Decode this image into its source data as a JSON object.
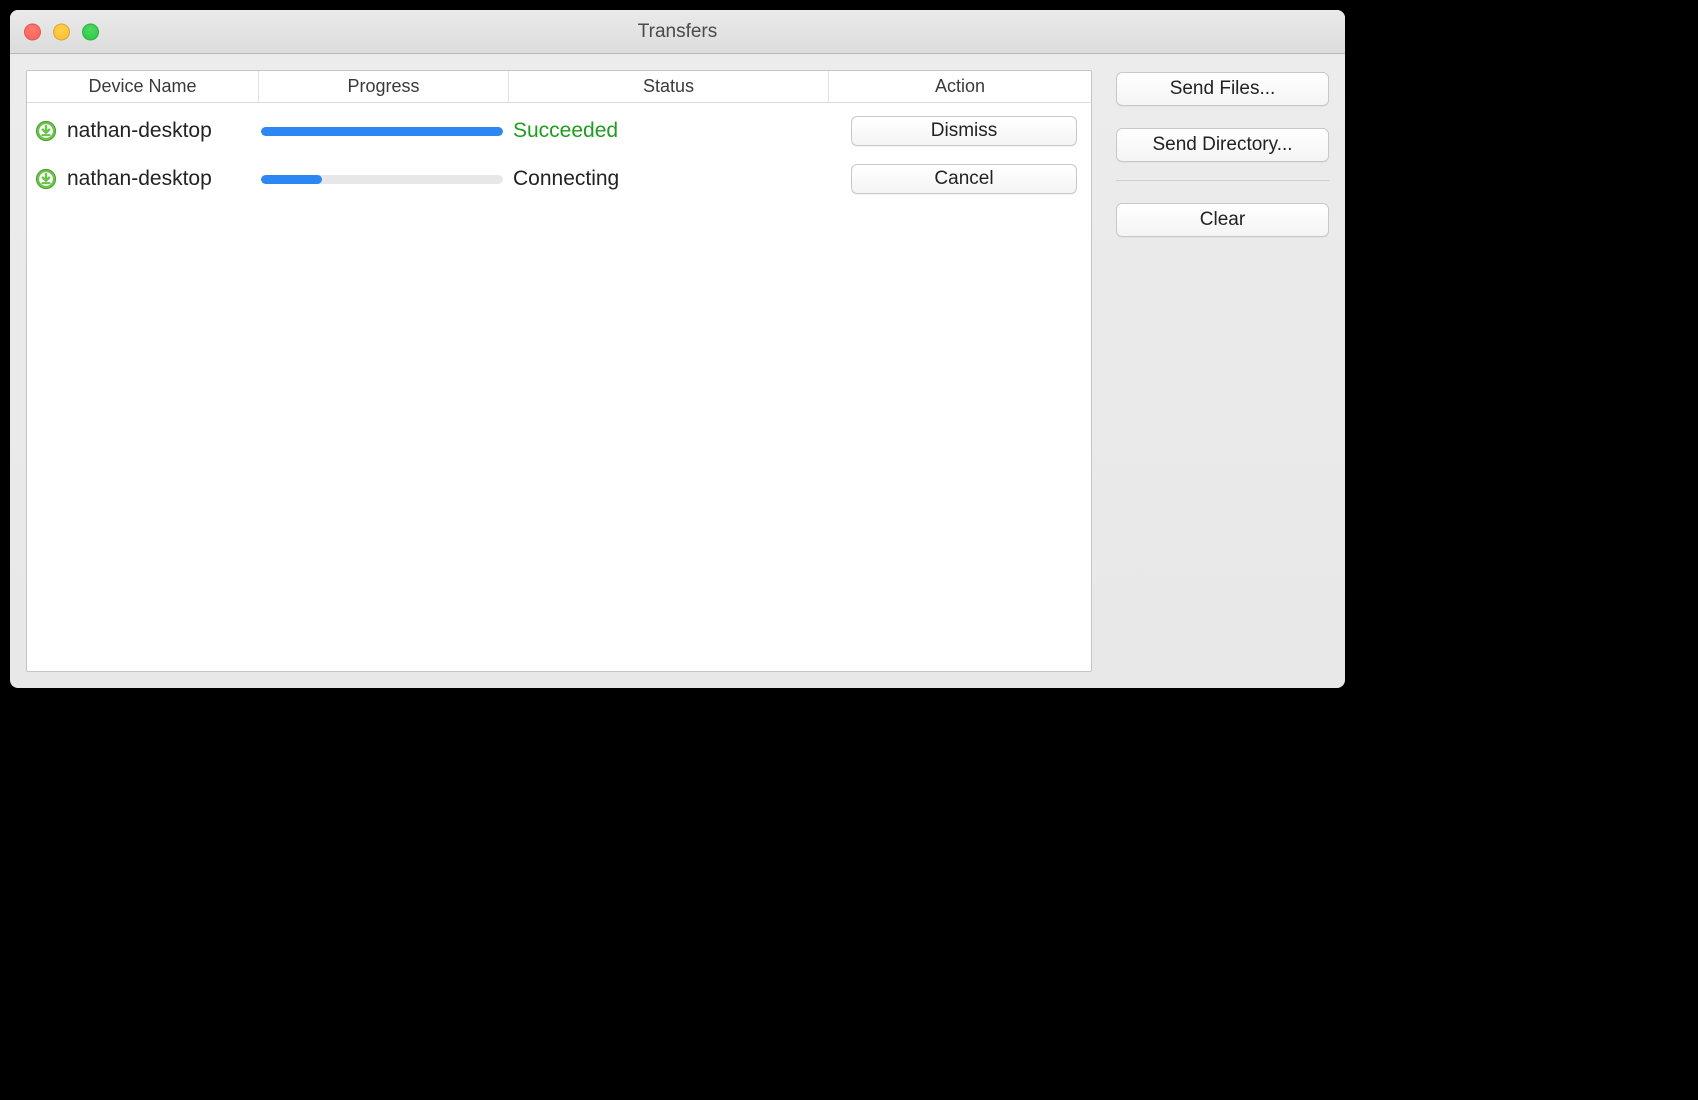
{
  "window": {
    "title": "Transfers"
  },
  "columns": {
    "device": "Device Name",
    "progress": "Progress",
    "status": "Status",
    "action": "Action"
  },
  "rows": [
    {
      "device": "nathan-desktop",
      "progress_percent": 100,
      "status_text": "Succeeded",
      "status_kind": "succeeded",
      "action_label": "Dismiss"
    },
    {
      "device": "nathan-desktop",
      "progress_percent": 25,
      "status_text": "Connecting",
      "status_kind": "connecting",
      "action_label": "Cancel"
    }
  ],
  "sidebar": {
    "send_files": "Send Files...",
    "send_directory": "Send Directory...",
    "clear": "Clear"
  },
  "icons": {
    "download": "download-icon"
  },
  "colors": {
    "progress_fill": "#2d87f3",
    "status_success": "#1f9d1f"
  }
}
